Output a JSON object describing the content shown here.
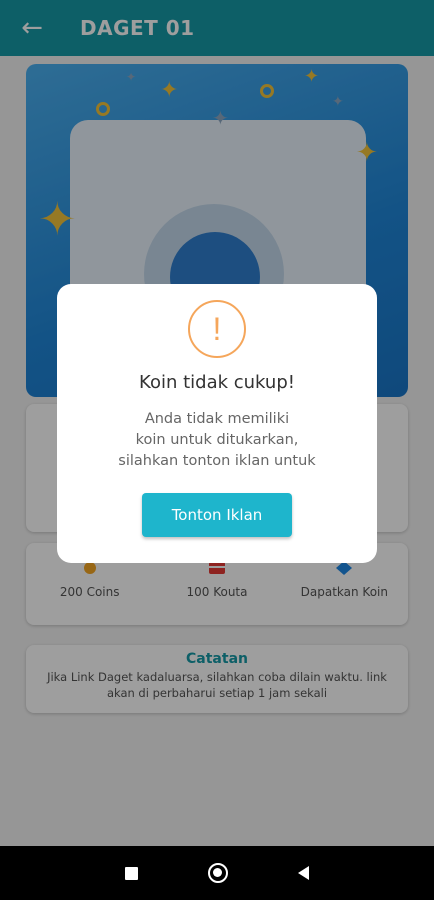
{
  "appbar": {
    "title": "DAGET 01",
    "back_icon": "arrow-left-icon"
  },
  "menu": {
    "items": [
      {
        "label": "200 Coins",
        "icon": "coin-icon",
        "color": "#f5a623"
      },
      {
        "label": "100 Kouta",
        "icon": "ticket-icon",
        "color": "#e53935"
      },
      {
        "label": "Dapatkan Koin",
        "icon": "diamond-icon",
        "color": "#1e88e5"
      }
    ]
  },
  "note": {
    "title": "Catatan",
    "text": "Jika Link Daget kadaluarsa, silahkan coba dilain waktu. link akan di perbaharui setiap 1 jam sekali"
  },
  "dialog": {
    "icon": "warning-icon",
    "icon_glyph": "!",
    "title": "Koin tidak cukup!",
    "message_line1": "Anda tidak memiliki",
    "message_line2": "koin untuk ditukarkan,",
    "message_line3": "silahkan tonton iklan untuk",
    "button_label": "Tonton Iklan"
  },
  "colors": {
    "primary": "#159aa6",
    "button": "#1eb5cc",
    "warning": "#f5a65b"
  },
  "navbar": {
    "icons": [
      "recents-icon",
      "home-icon",
      "back-icon"
    ]
  }
}
